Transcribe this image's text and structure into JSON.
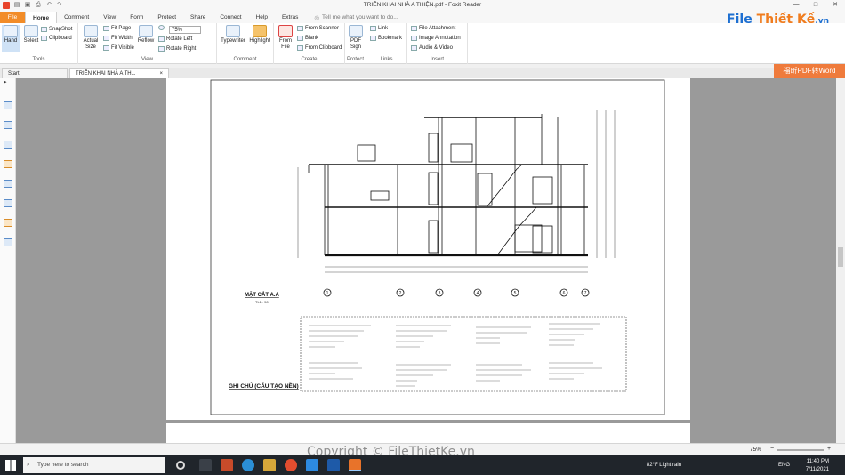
{
  "window": {
    "title": "TRIỂN KHAI NHÀ A THIỆN.pdf - Foxit Reader"
  },
  "tabs": [
    {
      "label": "File"
    },
    {
      "label": "Home"
    },
    {
      "label": "Comment"
    },
    {
      "label": "View"
    },
    {
      "label": "Form"
    },
    {
      "label": "Protect"
    },
    {
      "label": "Share"
    },
    {
      "label": "Connect"
    },
    {
      "label": "Help"
    },
    {
      "label": "Extras"
    }
  ],
  "tell_me": {
    "placeholder": "Tell me what you want to do..."
  },
  "ribbon": {
    "tools": {
      "label": "Tools",
      "hand": "Hand",
      "select": "Select",
      "snapshot": "SnapShot",
      "clipboard": "Clipboard"
    },
    "view": {
      "label": "View",
      "actual_size": "Actual Size",
      "fit_page": "Fit Page",
      "fit_width": "Fit Width",
      "fit_visible": "Fit Visible",
      "reflow": "Reflow",
      "zoom": "75%",
      "rotate_left": "Rotate Left",
      "rotate_right": "Rotate Right"
    },
    "comment": {
      "label": "Comment",
      "typewriter": "Typewriter",
      "highlight": "Highlight"
    },
    "create": {
      "label": "Create",
      "from_file": "From File",
      "from_scanner": "From Scanner",
      "blank": "Blank",
      "from_clipboard": "From Clipboard"
    },
    "protect": {
      "label": "Protect",
      "pdf_sign": "PDF Sign"
    },
    "links": {
      "label": "Links",
      "link": "Link",
      "bookmark": "Bookmark"
    },
    "insert": {
      "label": "Insert",
      "file_attachment": "File Attachment",
      "image_annotation": "Image Annotation",
      "audio_video": "Audio & Video"
    }
  },
  "brand": {
    "logo_left": "File",
    "logo_mid": "Thiết Kế",
    "logo_right": ".vn"
  },
  "doc_tabs": [
    {
      "label": "Start"
    },
    {
      "label": "TRIỂN KHAI NHÀ A TH...",
      "close": "×"
    }
  ],
  "pdf_to_word": "福昕PDF转Word",
  "drawing": {
    "section_title": "MẶT CẮT A.A",
    "scale": "TL1 : 50",
    "notes_title": "GHI CHÚ (CẤU TẠO NỀN)",
    "grid_labels": [
      "1",
      "2",
      "3",
      "4",
      "5",
      "6",
      "7"
    ]
  },
  "statusbar": {
    "zoom": "75%"
  },
  "watermark": "Copyright © FileThietKe.vn",
  "taskbar": {
    "search_placeholder": "Type here to search",
    "weather": "82°F  Light rain",
    "lang": "ENG",
    "time": "11:40 PM",
    "date": "7/11/2021"
  }
}
